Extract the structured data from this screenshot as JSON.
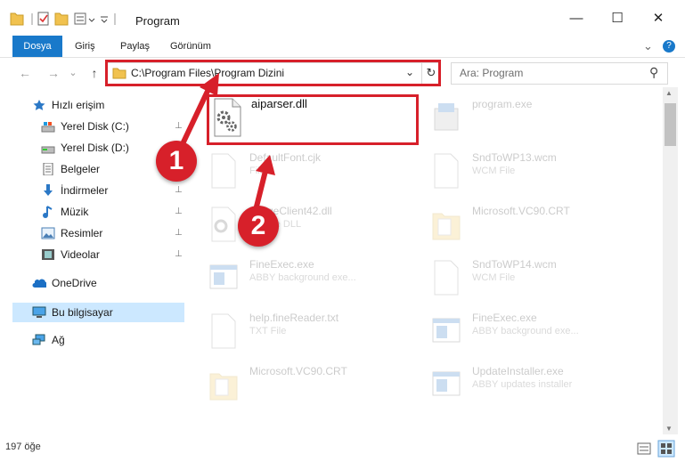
{
  "window": {
    "title": "Program",
    "controls": {
      "minimize": "—",
      "maximize": "☐",
      "close": "✕"
    }
  },
  "ribbon": {
    "tabs": [
      "Dosya",
      "Giriş",
      "Paylaş",
      "Görünüm"
    ],
    "expand": "⌄",
    "help": "?"
  },
  "navigation": {
    "back": "←",
    "forward": "→",
    "recent": "⌄",
    "up": "↑",
    "address": "C:\\Program Files\\Program Dizini",
    "address_dropdown": "⌄",
    "refresh": "↻",
    "search_placeholder": "Ara: Program",
    "search_icon": "⚲"
  },
  "sidebar": {
    "items": [
      {
        "label": "Hızlı erişim",
        "icon": "star-icon",
        "pinned": false
      },
      {
        "label": "Yerel Disk (C:)",
        "icon": "drive-icon",
        "pinned": true
      },
      {
        "label": "Yerel Disk (D:)",
        "icon": "drive-icon",
        "pinned": true
      },
      {
        "label": "Belgeler",
        "icon": "documents-icon",
        "pinned": true
      },
      {
        "label": "İndirmeler",
        "icon": "download-icon",
        "pinned": true
      },
      {
        "label": "Müzik",
        "icon": "music-icon",
        "pinned": true
      },
      {
        "label": "Resimler",
        "icon": "pictures-icon",
        "pinned": true
      },
      {
        "label": "Videolar",
        "icon": "videos-icon",
        "pinned": true
      },
      {
        "label": "OneDrive",
        "icon": "cloud-icon",
        "pinned": false
      },
      {
        "label": "Bu bilgisayar",
        "icon": "computer-icon",
        "pinned": false,
        "selected": true
      },
      {
        "label": "Ağ",
        "icon": "network-icon",
        "pinned": false
      }
    ],
    "pin_glyph": "📌"
  },
  "files": {
    "highlighted": {
      "name": "aiparser.dll",
      "icon": "dll-gear-icon"
    },
    "left_column": [
      {
        "name": "DefaultFont.cjk",
        "type": "File",
        "icon": "blank-file-icon"
      },
      {
        "name": "ImageClient42.dll",
        "type": "Source DLL",
        "icon": "dll-gear-icon"
      },
      {
        "name": "FineExec.exe",
        "type": "ABBY background exe...",
        "icon": "exe-window-icon"
      },
      {
        "name": "help.fineReader.txt",
        "type": "TXT File",
        "icon": "blank-file-icon"
      },
      {
        "name": "Microsoft.VC90.CRT",
        "type": "",
        "icon": "folder-doc-icon"
      }
    ],
    "right_column": [
      {
        "name": "program.exe",
        "type": "",
        "icon": "installer-icon"
      },
      {
        "name": "SndToWP13.wcm",
        "type": "WCM File",
        "icon": "blank-file-icon"
      },
      {
        "name": "Microsoft.VC90.CRT",
        "type": "",
        "icon": "folder-doc-icon"
      },
      {
        "name": "SndToWP14.wcm",
        "type": "WCM File",
        "icon": "blank-file-icon"
      },
      {
        "name": "FineExec.exe",
        "type": "ABBY background exe...",
        "icon": "exe-window-icon"
      },
      {
        "name": "UpdateInstaller.exe",
        "type": "ABBY updates installer",
        "icon": "exe-window-icon"
      }
    ]
  },
  "status": {
    "count": "197 öğe"
  },
  "annotations": {
    "step1": "1",
    "step2": "2",
    "color": "#d7202a"
  },
  "colors": {
    "accent": "#1979ca",
    "selection": "#cce8ff"
  }
}
